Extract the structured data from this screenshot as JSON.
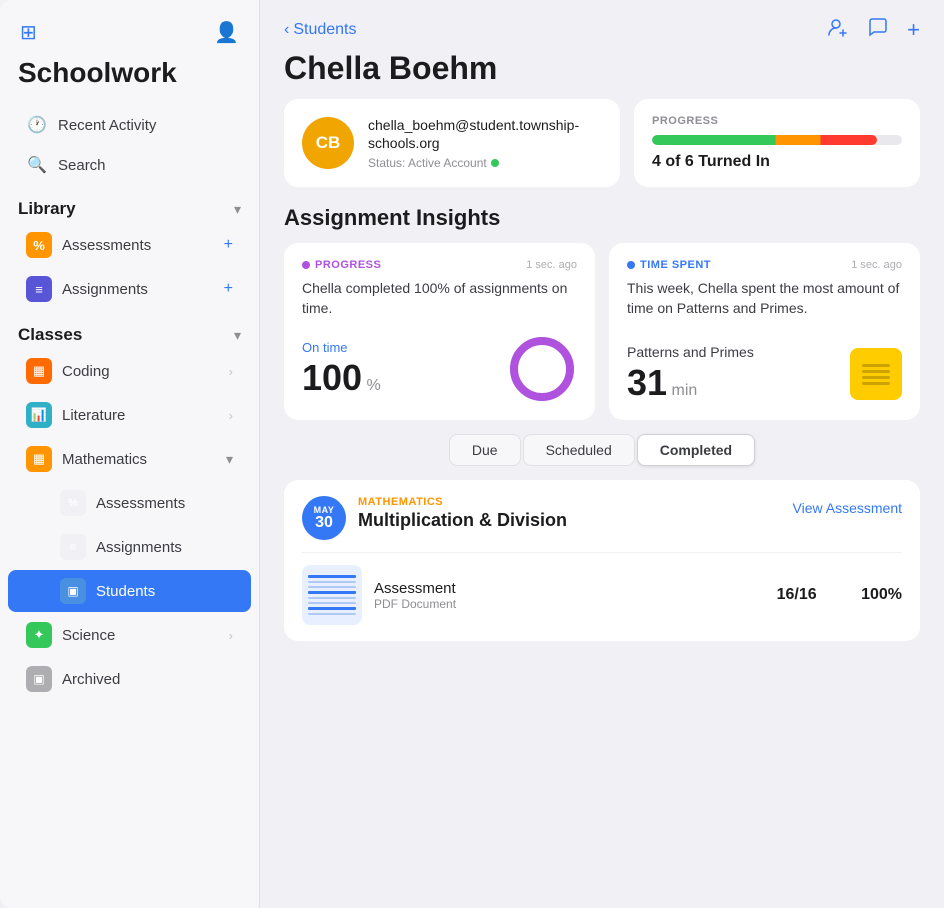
{
  "app": {
    "title": "Schoolwork"
  },
  "sidebar": {
    "title": "Schoolwork",
    "nav": [
      {
        "id": "recent-activity",
        "label": "Recent Activity",
        "icon": "🕐"
      },
      {
        "id": "search",
        "label": "Search",
        "icon": "🔍"
      }
    ],
    "library": {
      "title": "Library",
      "items": [
        {
          "id": "assessments",
          "label": "Assessments",
          "icon": "%"
        },
        {
          "id": "assignments",
          "label": "Assignments",
          "icon": "≡"
        }
      ]
    },
    "classes": {
      "title": "Classes",
      "items": [
        {
          "id": "coding",
          "label": "Coding",
          "icon": "▦"
        },
        {
          "id": "literature",
          "label": "Literature",
          "icon": "📊"
        },
        {
          "id": "mathematics",
          "label": "Mathematics",
          "icon": "▦",
          "expanded": true,
          "children": [
            {
              "id": "math-assessments",
              "label": "Assessments",
              "icon": "%"
            },
            {
              "id": "math-assignments",
              "label": "Assignments",
              "icon": "≡"
            },
            {
              "id": "math-students",
              "label": "Students",
              "icon": "▣",
              "active": true
            }
          ]
        },
        {
          "id": "science",
          "label": "Science",
          "icon": "✦"
        }
      ]
    },
    "archived": {
      "label": "Archived",
      "icon": "▣"
    }
  },
  "main": {
    "back_label": "Students",
    "student_name": "Chella Boehm",
    "student": {
      "initials": "CB",
      "email": "chella_boehm@student.township-schools.org",
      "status_label": "Status: Active Account"
    },
    "progress": {
      "label": "PROGRESS",
      "bar_width": "90%",
      "summary": "4 of 6 Turned In"
    },
    "insights_heading": "Assignment Insights",
    "insights": [
      {
        "type_label": "PROGRESS",
        "type": "progress",
        "timestamp": "1 sec. ago",
        "description": "Chella completed 100% of assignments on time.",
        "metric_label": "On time",
        "metric_value": "100",
        "metric_unit": "%",
        "chart_type": "donut",
        "chart_pct": 100
      },
      {
        "type_label": "TIME SPENT",
        "type": "time",
        "timestamp": "1 sec. ago",
        "description": "This week, Chella spent the most amount of time on Patterns and Primes.",
        "sub_label": "Patterns and Primes",
        "metric_value": "31",
        "metric_unit": "min",
        "chart_type": "notebook"
      }
    ],
    "tabs": [
      {
        "id": "due",
        "label": "Due"
      },
      {
        "id": "scheduled",
        "label": "Scheduled"
      },
      {
        "id": "completed",
        "label": "Completed",
        "active": true
      }
    ],
    "assignments": [
      {
        "date_month": "MAY",
        "date_day": "30",
        "subject": "MATHEMATICS",
        "title": "Multiplication & Division",
        "view_btn_label": "View Assessment",
        "item_name": "Assessment",
        "item_type": "PDF Document",
        "score_fraction": "16/16",
        "score_percent": "100%"
      }
    ]
  }
}
